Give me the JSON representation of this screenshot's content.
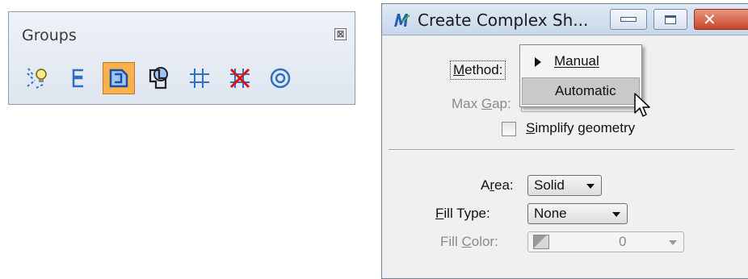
{
  "groups_toolbox": {
    "title": "Groups",
    "close_glyph": "⊠",
    "tools": [
      {
        "icon": "group-lightbulb-icon"
      },
      {
        "icon": "chain-icon"
      },
      {
        "icon": "complex-shape-icon",
        "active": true
      },
      {
        "icon": "region-icon"
      },
      {
        "icon": "hatch-icon"
      },
      {
        "icon": "delete-pattern-icon"
      },
      {
        "icon": "concentric-circle-icon"
      }
    ],
    "active_color": "#f9b04e"
  },
  "dialog": {
    "title": "Create Complex Sh...",
    "close_glyph": "✕",
    "method": {
      "label_pre": "",
      "label_ul": "M",
      "label_post": "ethod:",
      "options": [
        "Manual",
        "Automatic"
      ],
      "checked": "Manual",
      "highlighted": "Automatic"
    },
    "max_gap": {
      "label_pre": "Max ",
      "label_ul": "G",
      "label_post": "ap:",
      "value": ""
    },
    "simplify": {
      "label_pre": "",
      "label_ul": "S",
      "label_post": "implify geometry",
      "checked": false
    },
    "area": {
      "label_pre": "A",
      "label_ul": "r",
      "label_post": "ea:",
      "value": "Solid"
    },
    "fill_type": {
      "label_pre": "",
      "label_ul": "F",
      "label_post": "ill Type:",
      "value": "None"
    },
    "fill_color": {
      "label_pre": "Fill ",
      "label_ul": "C",
      "label_post": "olor:",
      "value": "0"
    }
  }
}
